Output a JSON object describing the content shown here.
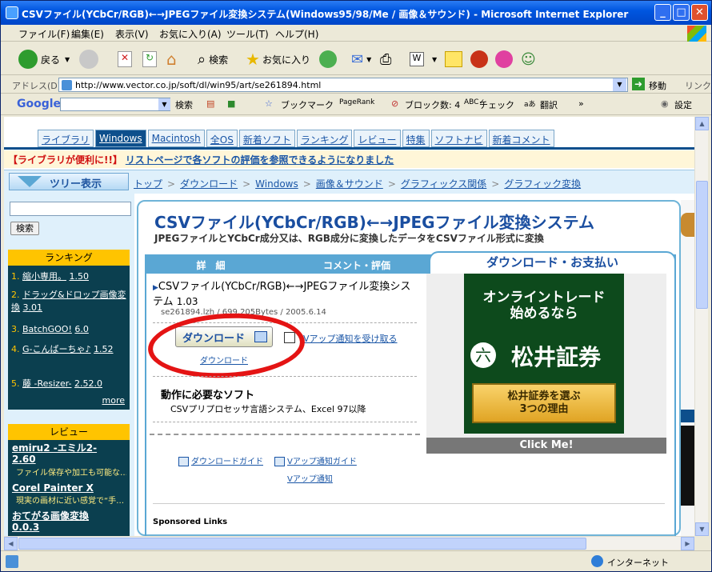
{
  "window": {
    "title": "CSVファイル(YCbCr/RGB)←→JPEGファイル変換システム(Windows95/98/Me / 画像＆サウンド) - Microsoft Internet Explorer",
    "min": "_",
    "max": "□",
    "close": "✕"
  },
  "menu": [
    "ファイル(F)",
    "編集(E)",
    "表示(V)",
    "お気に入り(A)",
    "ツール(T)",
    "ヘルプ(H)"
  ],
  "toolbar": {
    "back": "戻る",
    "search": "検索",
    "favorites": "お気に入り"
  },
  "address": {
    "label": "アドレス(D)",
    "url": "http://www.vector.co.jp/soft/dl/win95/art/se261894.html",
    "go": "移動",
    "links": "リンク"
  },
  "google": {
    "logo": "Google",
    "search": "検索",
    "bookmark": "ブックマーク",
    "pagerank": "PageRank",
    "blocked": "ブロック数: 4",
    "check": "チェック",
    "translate": "翻訳",
    "settings": "設定"
  },
  "nav": {
    "tabs": [
      "ライブラリ",
      "Windows",
      "Macintosh",
      "全OS",
      "新着ソフト",
      "ランキング",
      "レビュー",
      "特集",
      "ソフトナビ",
      "新着コメント"
    ],
    "active": "Windows"
  },
  "announce": {
    "tag": "【ライブラリが便利に!!】",
    "text": "リストページで各ソフトの評価を参照できるようになりました"
  },
  "tree_button": "ツリー表示",
  "breadcrumbs": [
    "トップ",
    "ダウンロード",
    "Windows",
    "画像＆サウンド",
    "グラフィックス関係",
    "グラフィック変換"
  ],
  "sidebar": {
    "search_btn": "検索",
    "ranking": {
      "title": "ランキング",
      "items": [
        {
          "n": "1.",
          "t": "縮小専用。",
          "v": "1.50"
        },
        {
          "n": "2.",
          "t": "ドラッグ&ドロップ画像変換",
          "v": "3.01"
        },
        {
          "n": "3.",
          "t": "BatchGOO!",
          "v": "6.0"
        },
        {
          "n": "4.",
          "t": "G-こんばーちゃ♪",
          "v": "1.52"
        },
        {
          "n": "5.",
          "t": "藤 -Resizer-",
          "v": "2.52.0"
        }
      ],
      "more": "more"
    },
    "review": {
      "title": "レビュー",
      "items": [
        {
          "t": "emiru2 -エミル2-",
          "v": "2.60",
          "d": "ファイル保存や加工も可能な…"
        },
        {
          "t": "Corel Painter X",
          "v": "",
          "d": "現実の画材に近い感覚で“手…"
        },
        {
          "t": "おてがる画像変換",
          "v": "0.0.3",
          "d": ""
        }
      ]
    }
  },
  "main": {
    "title": "CSVファイル(YCbCr/RGB)←→JPEGファイル変換システム",
    "subtitle": "JPEGファイルとYCbCr成分又は、RGB成分に変換したデータをCSVファイル形式に変換",
    "tab_detail": "詳　細",
    "tab_comment": "コメント・評価",
    "tab_download": "ダウンロード・お支払い",
    "software_name": "CSVファイル(YCbCr/RGB)←→JPEGファイル変換システム",
    "version": "1.03",
    "file_meta": "se261894.lzh / 699,205Bytes / 2005.6.14",
    "download_button": "ダウンロード",
    "download_link": "ダウンロード",
    "notify_label": "Vアップ通知を受け取る",
    "req_heading": "動作に必要なソフト",
    "req_text": "CSVプリプロセッサ言語システム、Excel 97以降",
    "guide_download": "ダウンロードガイド",
    "guide_vup": "Vアップ通知ガイド",
    "vup_link": "Vアップ通知",
    "sponsored": "Sponsored Links"
  },
  "ad": {
    "line1": "オンライントレード",
    "line2": "始めるなら",
    "brand": "松井証券",
    "seal": "六",
    "cta1": "松井証券を選ぶ",
    "cta2": "3つの理由",
    "clickme": "Click Me!"
  },
  "status": {
    "zone": "インターネット"
  }
}
